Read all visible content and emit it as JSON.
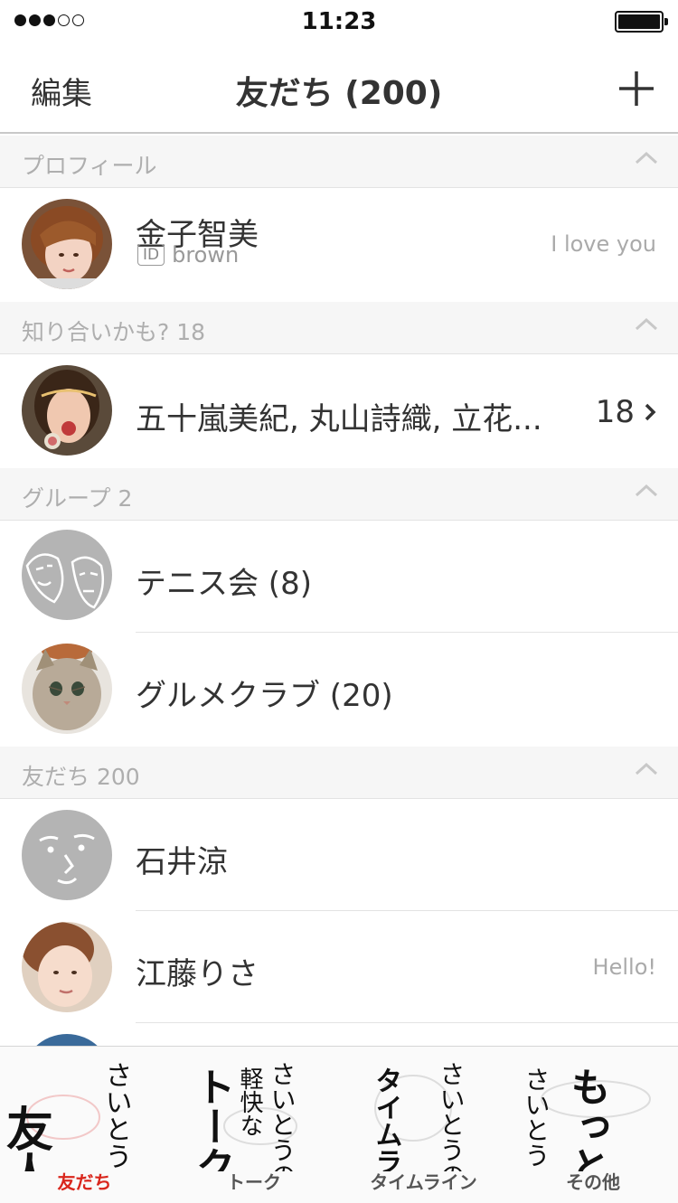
{
  "status_bar": {
    "time": "11:23",
    "signal_bars_filled": 3,
    "signal_bars_total": 5
  },
  "nav": {
    "edit_label": "編集",
    "title": "友だち (200)",
    "add_icon": "plus-icon"
  },
  "sections": {
    "profile": {
      "header": "プロフィール",
      "name": "金子智美",
      "id_badge": "ID",
      "id_value": "brown",
      "status": "I love you"
    },
    "suggested": {
      "header": "知り合いかも? 18",
      "names": "五十嵐美紀, 丸山詩織, 立花...",
      "count": "18"
    },
    "groups": {
      "header": "グループ 2",
      "items": [
        {
          "name": "テニス会 (8)"
        },
        {
          "name": "グルメクラブ (20)"
        }
      ]
    },
    "friends": {
      "header": "友だち 200",
      "items": [
        {
          "name": "石井涼",
          "status": ""
        },
        {
          "name": "江藤りさ",
          "status": "Hello!"
        }
      ]
    }
  },
  "tab_bar": {
    "tabs": [
      {
        "label": "友だち",
        "art_main": "友人",
        "art_sub": "さいとうの",
        "active": true
      },
      {
        "label": "トーク",
        "art_main": "トーク",
        "art_sub": "さいとうの",
        "art_extra": "軽快な",
        "active": false
      },
      {
        "label": "タイムライン",
        "art_main": "タイムライン",
        "art_sub": "さいとうの",
        "active": false
      },
      {
        "label": "その他",
        "art_main": "もっと",
        "art_sub": "さいとう",
        "active": false
      }
    ]
  },
  "colors": {
    "accent_active": "#d9261c",
    "section_bg": "#f6f6f6",
    "divider": "#e3e3e3",
    "muted_text": "#aeaeae"
  }
}
